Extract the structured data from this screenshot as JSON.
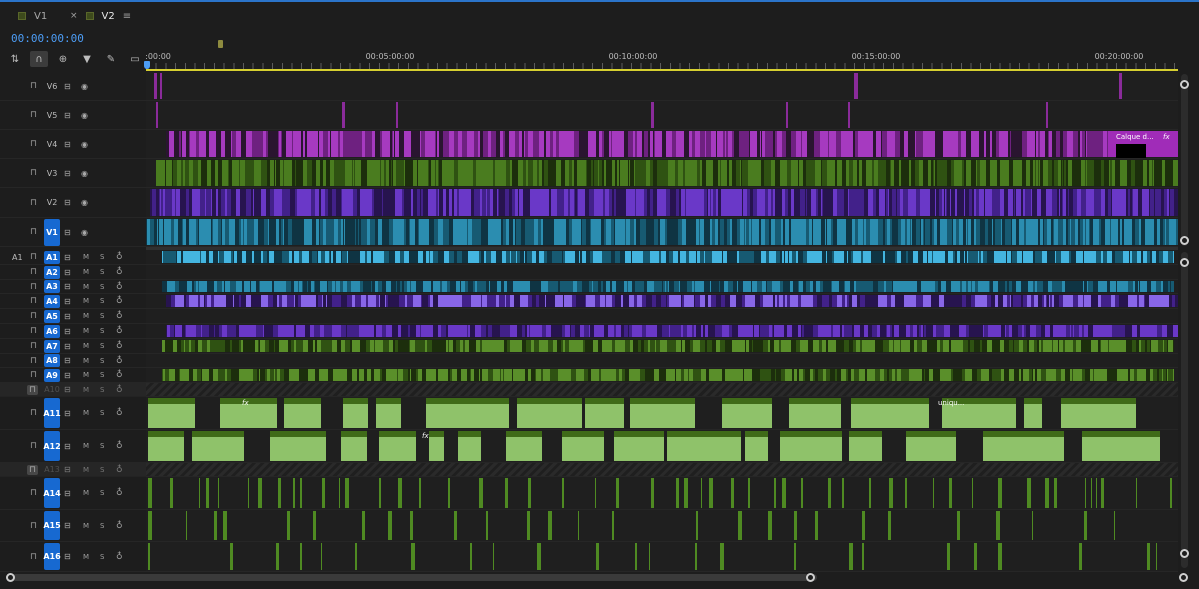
{
  "tabs": [
    {
      "label": "V1",
      "active": false
    },
    {
      "label": "V2",
      "active": true,
      "close": "×",
      "menu": "≡"
    }
  ],
  "timecode": "00:00:00:00",
  "tools": [
    "insert-overwrite-icon",
    "snap-icon",
    "linked-selection-icon",
    "marker-icon",
    "wrench-icon",
    "captions-icon"
  ],
  "ruler": {
    "labels": [
      ":00:00",
      "00:05:00:00",
      "00:10:00:00",
      "00:15:00:00",
      "00:20:00:00"
    ]
  },
  "video_tracks": [
    {
      "name": "V6"
    },
    {
      "name": "V5"
    },
    {
      "name": "V4"
    },
    {
      "name": "V3"
    },
    {
      "name": "V2"
    },
    {
      "name": "V1",
      "selected": true
    }
  ],
  "audio_tracks": [
    {
      "name": "A1",
      "source": "A1",
      "selected": true
    },
    {
      "name": "A2",
      "selected": true
    },
    {
      "name": "A3",
      "selected": true
    },
    {
      "name": "A4",
      "selected": true
    },
    {
      "name": "A5",
      "selected": true
    },
    {
      "name": "A6",
      "selected": true
    },
    {
      "name": "A7",
      "selected": true
    },
    {
      "name": "A8",
      "selected": true
    },
    {
      "name": "A9",
      "selected": true
    },
    {
      "name": "A10",
      "locked": true
    },
    {
      "name": "A11",
      "selected": true
    },
    {
      "name": "A12",
      "selected": true
    },
    {
      "name": "A13",
      "locked": true
    },
    {
      "name": "A14",
      "selected": true
    },
    {
      "name": "A15",
      "selected": true
    },
    {
      "name": "A16",
      "selected": true
    }
  ],
  "labels": {
    "mute": "M",
    "solo": "S"
  },
  "clip_labels": {
    "v4_title": "Calque d...",
    "fx": "fx",
    "a11_name": "uniqu..."
  },
  "colors": {
    "accent": "#1769d1",
    "timecode": "#4d9df5",
    "work_area": "#d6cf30",
    "purple": "#8a2b9a",
    "violet": "#5a2aa8",
    "green": "#3f6b18",
    "blue": "#1d6f8d",
    "light_green": "#8fc26a"
  }
}
